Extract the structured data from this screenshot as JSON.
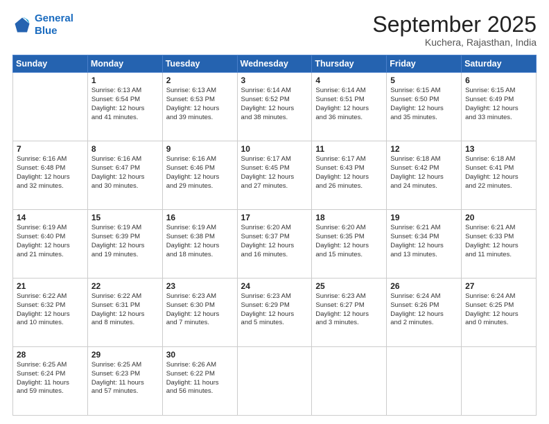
{
  "header": {
    "logo_line1": "General",
    "logo_line2": "Blue",
    "month": "September 2025",
    "location": "Kuchera, Rajasthan, India"
  },
  "weekdays": [
    "Sunday",
    "Monday",
    "Tuesday",
    "Wednesday",
    "Thursday",
    "Friday",
    "Saturday"
  ],
  "weeks": [
    [
      {
        "day": "",
        "text": ""
      },
      {
        "day": "1",
        "text": "Sunrise: 6:13 AM\nSunset: 6:54 PM\nDaylight: 12 hours\nand 41 minutes."
      },
      {
        "day": "2",
        "text": "Sunrise: 6:13 AM\nSunset: 6:53 PM\nDaylight: 12 hours\nand 39 minutes."
      },
      {
        "day": "3",
        "text": "Sunrise: 6:14 AM\nSunset: 6:52 PM\nDaylight: 12 hours\nand 38 minutes."
      },
      {
        "day": "4",
        "text": "Sunrise: 6:14 AM\nSunset: 6:51 PM\nDaylight: 12 hours\nand 36 minutes."
      },
      {
        "day": "5",
        "text": "Sunrise: 6:15 AM\nSunset: 6:50 PM\nDaylight: 12 hours\nand 35 minutes."
      },
      {
        "day": "6",
        "text": "Sunrise: 6:15 AM\nSunset: 6:49 PM\nDaylight: 12 hours\nand 33 minutes."
      }
    ],
    [
      {
        "day": "7",
        "text": "Sunrise: 6:16 AM\nSunset: 6:48 PM\nDaylight: 12 hours\nand 32 minutes."
      },
      {
        "day": "8",
        "text": "Sunrise: 6:16 AM\nSunset: 6:47 PM\nDaylight: 12 hours\nand 30 minutes."
      },
      {
        "day": "9",
        "text": "Sunrise: 6:16 AM\nSunset: 6:46 PM\nDaylight: 12 hours\nand 29 minutes."
      },
      {
        "day": "10",
        "text": "Sunrise: 6:17 AM\nSunset: 6:45 PM\nDaylight: 12 hours\nand 27 minutes."
      },
      {
        "day": "11",
        "text": "Sunrise: 6:17 AM\nSunset: 6:43 PM\nDaylight: 12 hours\nand 26 minutes."
      },
      {
        "day": "12",
        "text": "Sunrise: 6:18 AM\nSunset: 6:42 PM\nDaylight: 12 hours\nand 24 minutes."
      },
      {
        "day": "13",
        "text": "Sunrise: 6:18 AM\nSunset: 6:41 PM\nDaylight: 12 hours\nand 22 minutes."
      }
    ],
    [
      {
        "day": "14",
        "text": "Sunrise: 6:19 AM\nSunset: 6:40 PM\nDaylight: 12 hours\nand 21 minutes."
      },
      {
        "day": "15",
        "text": "Sunrise: 6:19 AM\nSunset: 6:39 PM\nDaylight: 12 hours\nand 19 minutes."
      },
      {
        "day": "16",
        "text": "Sunrise: 6:19 AM\nSunset: 6:38 PM\nDaylight: 12 hours\nand 18 minutes."
      },
      {
        "day": "17",
        "text": "Sunrise: 6:20 AM\nSunset: 6:37 PM\nDaylight: 12 hours\nand 16 minutes."
      },
      {
        "day": "18",
        "text": "Sunrise: 6:20 AM\nSunset: 6:35 PM\nDaylight: 12 hours\nand 15 minutes."
      },
      {
        "day": "19",
        "text": "Sunrise: 6:21 AM\nSunset: 6:34 PM\nDaylight: 12 hours\nand 13 minutes."
      },
      {
        "day": "20",
        "text": "Sunrise: 6:21 AM\nSunset: 6:33 PM\nDaylight: 12 hours\nand 11 minutes."
      }
    ],
    [
      {
        "day": "21",
        "text": "Sunrise: 6:22 AM\nSunset: 6:32 PM\nDaylight: 12 hours\nand 10 minutes."
      },
      {
        "day": "22",
        "text": "Sunrise: 6:22 AM\nSunset: 6:31 PM\nDaylight: 12 hours\nand 8 minutes."
      },
      {
        "day": "23",
        "text": "Sunrise: 6:23 AM\nSunset: 6:30 PM\nDaylight: 12 hours\nand 7 minutes."
      },
      {
        "day": "24",
        "text": "Sunrise: 6:23 AM\nSunset: 6:29 PM\nDaylight: 12 hours\nand 5 minutes."
      },
      {
        "day": "25",
        "text": "Sunrise: 6:23 AM\nSunset: 6:27 PM\nDaylight: 12 hours\nand 3 minutes."
      },
      {
        "day": "26",
        "text": "Sunrise: 6:24 AM\nSunset: 6:26 PM\nDaylight: 12 hours\nand 2 minutes."
      },
      {
        "day": "27",
        "text": "Sunrise: 6:24 AM\nSunset: 6:25 PM\nDaylight: 12 hours\nand 0 minutes."
      }
    ],
    [
      {
        "day": "28",
        "text": "Sunrise: 6:25 AM\nSunset: 6:24 PM\nDaylight: 11 hours\nand 59 minutes."
      },
      {
        "day": "29",
        "text": "Sunrise: 6:25 AM\nSunset: 6:23 PM\nDaylight: 11 hours\nand 57 minutes."
      },
      {
        "day": "30",
        "text": "Sunrise: 6:26 AM\nSunset: 6:22 PM\nDaylight: 11 hours\nand 56 minutes."
      },
      {
        "day": "",
        "text": ""
      },
      {
        "day": "",
        "text": ""
      },
      {
        "day": "",
        "text": ""
      },
      {
        "day": "",
        "text": ""
      }
    ]
  ]
}
